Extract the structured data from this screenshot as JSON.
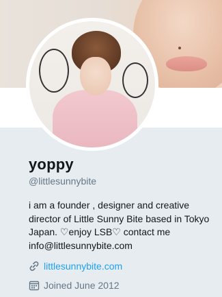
{
  "profile": {
    "name": "yoppy",
    "handle": "@littlesunnybite",
    "bio": "i am a founder , designer and creative director of Little Sunny Bite based in Tokyo Japan. ♡enjoy LSB♡ contact me info@littlesunnybite.com",
    "website": "littlesunnybite.com",
    "joined": "Joined June 2012"
  },
  "icons": {
    "link": "link-icon",
    "calendar": "calendar-icon"
  },
  "colors": {
    "link": "#1da1f2",
    "muted": "#657786",
    "background": "#e6ecf0"
  }
}
